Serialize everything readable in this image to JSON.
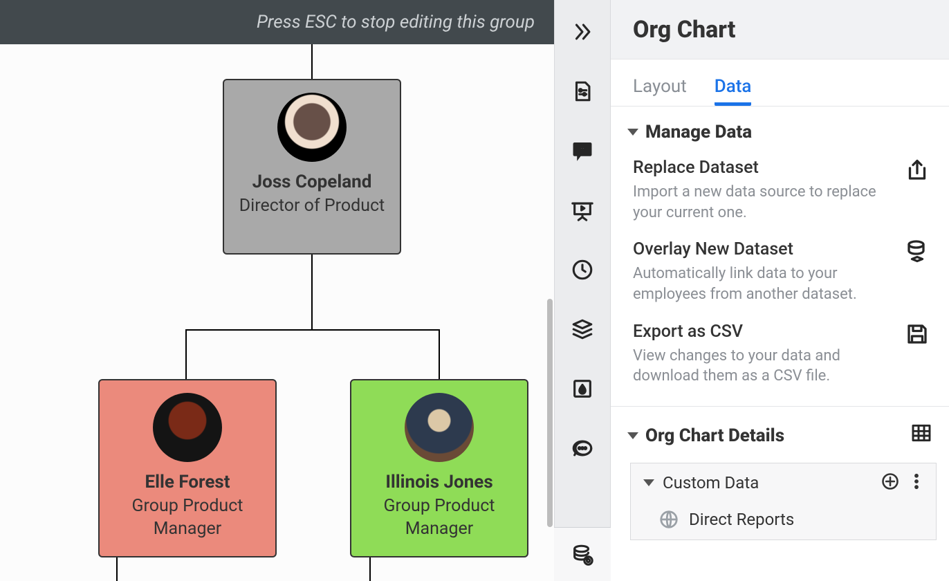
{
  "topbar": {
    "hint": "Press ESC to stop editing this group"
  },
  "org": {
    "root": {
      "name": "Joss Copeland",
      "title": "Director of Product"
    },
    "children": [
      {
        "name": "Elle Forest",
        "title": "Group Product Manager"
      },
      {
        "name": "Illinois Jones",
        "title": "Group Product Manager"
      }
    ]
  },
  "iconrail": {
    "items": [
      "expand",
      "settings-doc",
      "quote",
      "present",
      "clock",
      "layers",
      "ink",
      "chat",
      "db-link"
    ]
  },
  "panel": {
    "title": "Org Chart",
    "tabs": {
      "layout": "Layout",
      "data": "Data",
      "active": "data"
    },
    "manage": {
      "header": "Manage Data",
      "replace": {
        "title": "Replace Dataset",
        "desc": "Import a new data source to replace your current one."
      },
      "overlay": {
        "title": "Overlay New Dataset",
        "desc": "Automatically link data to your employees from another dataset."
      },
      "export": {
        "title": "Export as CSV",
        "desc": "View changes to your data and download them as a CSV file."
      }
    },
    "details": {
      "header": "Org Chart Details",
      "custom": {
        "header": "Custom Data",
        "child": "Direct Reports"
      }
    }
  }
}
